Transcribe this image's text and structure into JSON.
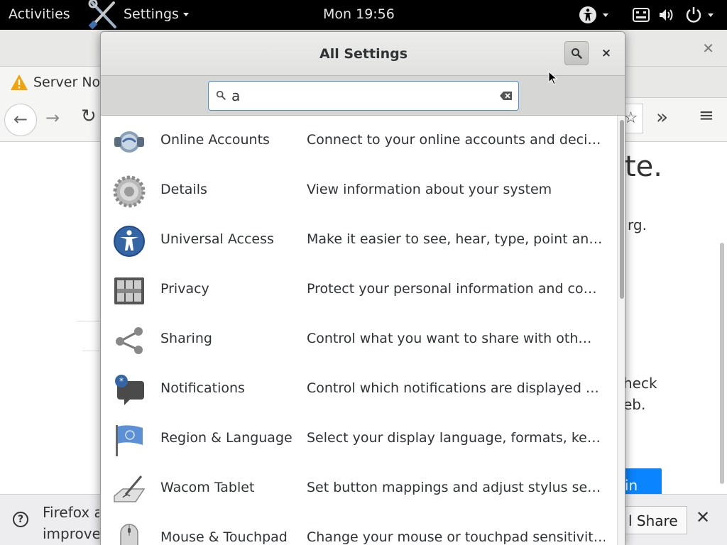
{
  "topbar": {
    "activities": "Activities",
    "app_menu": "Settings",
    "clock": "Mon 19:56"
  },
  "firefox": {
    "tab_title": "Server No",
    "content_fragments": {
      "big": "te.",
      "org": "rg.",
      "check": "heck",
      "web": "eb.",
      "button": "in"
    },
    "notification": {
      "text_line1": "Firefox a",
      "text_line2": "improve",
      "share_button": "l Share",
      "close": "✕"
    }
  },
  "settings_dialog": {
    "title": "All Settings",
    "close": "×",
    "search": {
      "value": "a",
      "placeholder": ""
    },
    "panels": [
      {
        "name": "Online Accounts",
        "description": "Connect to your online accounts and deci…",
        "icon": "online-accounts-icon"
      },
      {
        "name": "Details",
        "description": "View information about your system",
        "icon": "details-gear-icon"
      },
      {
        "name": "Universal Access",
        "description": "Make it easier to see, hear, type, point an…",
        "icon": "universal-access-icon"
      },
      {
        "name": "Privacy",
        "description": "Protect your personal information and co…",
        "icon": "privacy-icon"
      },
      {
        "name": "Sharing",
        "description": "Control what you want to share with oth…",
        "icon": "sharing-icon"
      },
      {
        "name": "Notifications",
        "description": "Control which notifications are displayed …",
        "icon": "notifications-icon"
      },
      {
        "name": "Region & Language",
        "description": "Select your display language, formats, ke…",
        "icon": "region-flag-icon"
      },
      {
        "name": "Wacom Tablet",
        "description": "Set button mappings and adjust stylus se…",
        "icon": "wacom-tablet-icon"
      },
      {
        "name": "Mouse & Touchpad",
        "description": "Change your mouse or touchpad sensitivit…",
        "icon": "mouse-icon"
      }
    ]
  },
  "colors": {
    "topbar_bg": "#000000",
    "dialog_header": "#e1e1df",
    "focus_blue": "#4a90d9",
    "firefox_blue": "#0a84ff"
  }
}
